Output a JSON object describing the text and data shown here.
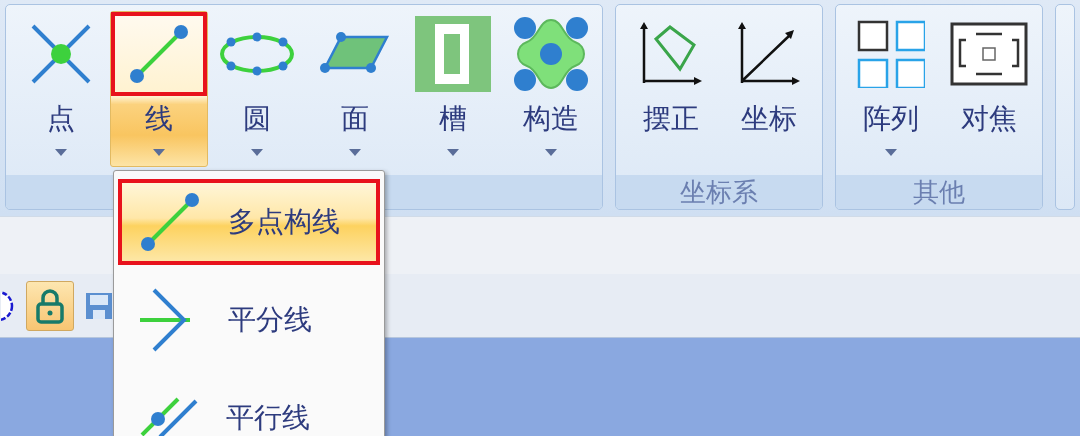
{
  "ribbon": {
    "groups": [
      {
        "buttons": [
          {
            "label": "点",
            "kind": "point",
            "dropdown": true,
            "selected": false,
            "annotated": false
          },
          {
            "label": "线",
            "kind": "line",
            "dropdown": true,
            "selected": true,
            "annotated": true
          },
          {
            "label": "圆",
            "kind": "ellipse",
            "dropdown": true,
            "selected": false,
            "annotated": false
          },
          {
            "label": "面",
            "kind": "plane",
            "dropdown": true,
            "selected": false,
            "annotated": false
          },
          {
            "label": "槽",
            "kind": "slot",
            "dropdown": true,
            "selected": false,
            "annotated": false
          },
          {
            "label": "构造",
            "kind": "construct",
            "dropdown": true,
            "selected": false,
            "annotated": false
          }
        ]
      },
      {
        "title": "坐标系",
        "buttons": [
          {
            "label": "摆正",
            "kind": "align",
            "dropdown": false,
            "selected": false,
            "annotated": false
          },
          {
            "label": "坐标",
            "kind": "axes",
            "dropdown": false,
            "selected": false,
            "annotated": false
          }
        ]
      },
      {
        "title": "其他",
        "buttons": [
          {
            "label": "阵列",
            "kind": "array",
            "dropdown": true,
            "selected": false,
            "annotated": false
          },
          {
            "label": "对焦",
            "kind": "focus",
            "dropdown": false,
            "selected": false,
            "annotated": false
          }
        ]
      }
    ]
  },
  "quick_toolbar": [
    {
      "kind": "circle",
      "on": false
    },
    {
      "kind": "lock",
      "on": true
    },
    {
      "kind": "save",
      "on": false
    }
  ],
  "dropdown_menu": {
    "items": [
      {
        "label": "多点构线",
        "kind": "polyline",
        "selected": true,
        "annotated": true
      },
      {
        "label": "平分线",
        "kind": "bisector",
        "selected": false,
        "annotated": false
      },
      {
        "label": "平行线",
        "kind": "parallel",
        "selected": false,
        "annotated": false
      }
    ]
  }
}
